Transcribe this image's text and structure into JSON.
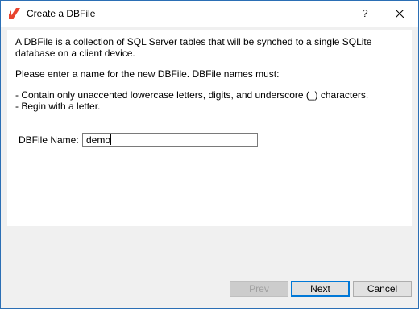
{
  "window": {
    "title": "Create a DBFile",
    "help_label": "?",
    "icon": "app-logo-icon",
    "close_icon": "close-icon"
  },
  "content": {
    "description": "A DBFile is a collection of SQL Server tables that will be synched to a single SQLite database on a client device.",
    "instructions": "Please enter a name for the new DBFile. DBFile names must:",
    "rule_1": "- Contain only unaccented lowercase letters, digits, and underscore (_) characters.",
    "rule_2": "- Begin with a letter."
  },
  "form": {
    "name_label": "DBFile Name:",
    "name_value": "demo"
  },
  "buttons": {
    "prev": "Prev",
    "next": "Next",
    "cancel": "Cancel"
  },
  "colors": {
    "accent": "#0078d7",
    "window_border": "#2b6fb5",
    "logo_red": "#e8432e"
  }
}
